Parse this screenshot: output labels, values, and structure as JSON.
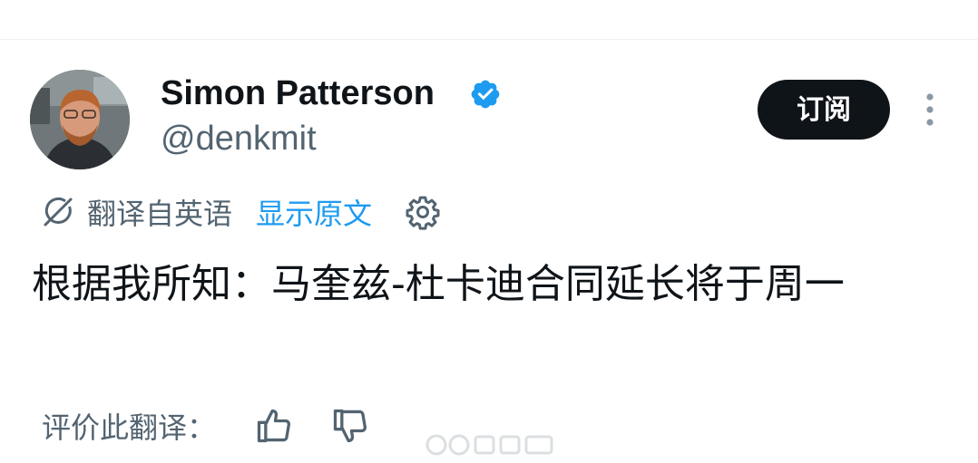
{
  "header": {
    "display_name": "Simon Patterson",
    "handle": "@denkmit",
    "verified": true,
    "subscribe_label": "订阅",
    "more_icon": "more-vertical-icon"
  },
  "translation": {
    "translated_from": "翻译自英语",
    "show_original": "显示原文",
    "settings_icon": "gear-icon"
  },
  "tweet": {
    "text": "根据我所知：马奎兹-杜卡迪合同延长将于周一"
  },
  "rating": {
    "label": "评价此翻译：",
    "up_icon": "thumbs-up-icon",
    "down_icon": "thumbs-down-icon"
  },
  "colors": {
    "text": "#0f1419",
    "secondary": "#536471",
    "link": "#1d9bf0",
    "verified": "#1d9bf0",
    "button_bg": "#0f1419",
    "divider": "#eff3f4"
  }
}
